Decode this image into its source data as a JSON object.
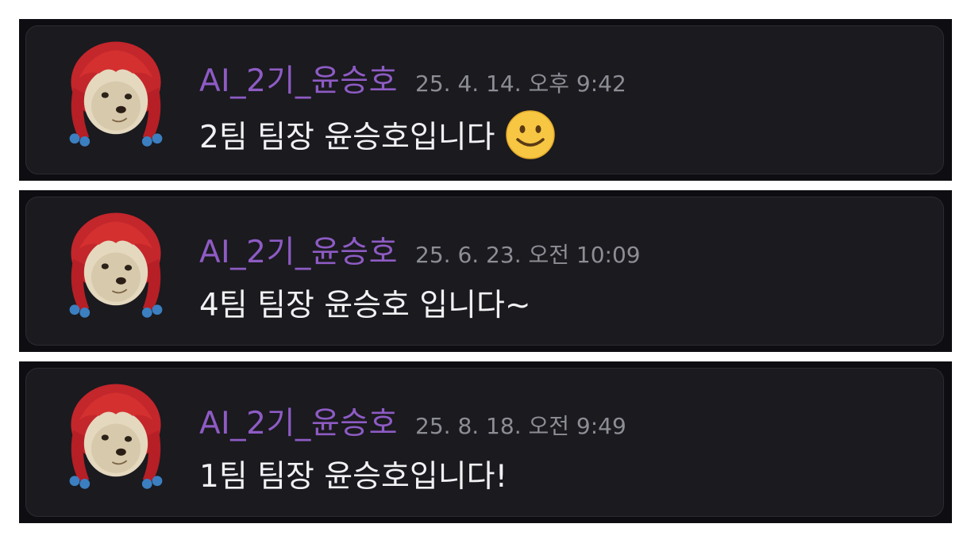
{
  "messages": [
    {
      "username": "AI_2기_윤승호",
      "timestamp": "25. 4. 14. 오후 9:42",
      "text": "2팀 팀장 윤승호입니다",
      "emoji": "slightly-smiling-face"
    },
    {
      "username": "AI_2기_윤승호",
      "timestamp": "25. 6. 23. 오전 10:09",
      "text": "4팀 팀장 윤승호 입니다~"
    },
    {
      "username": "AI_2기_윤승호",
      "timestamp": "25. 8. 18. 오전 9:49",
      "text": "1팀 팀장 윤승호입니다!"
    }
  ],
  "colors": {
    "username": "#8e5bc4",
    "timestamp": "#8d8d95",
    "message_text": "#f1f1f3",
    "card_bg": "#1a1a1f",
    "panel_bg": "#0e0e12"
  }
}
